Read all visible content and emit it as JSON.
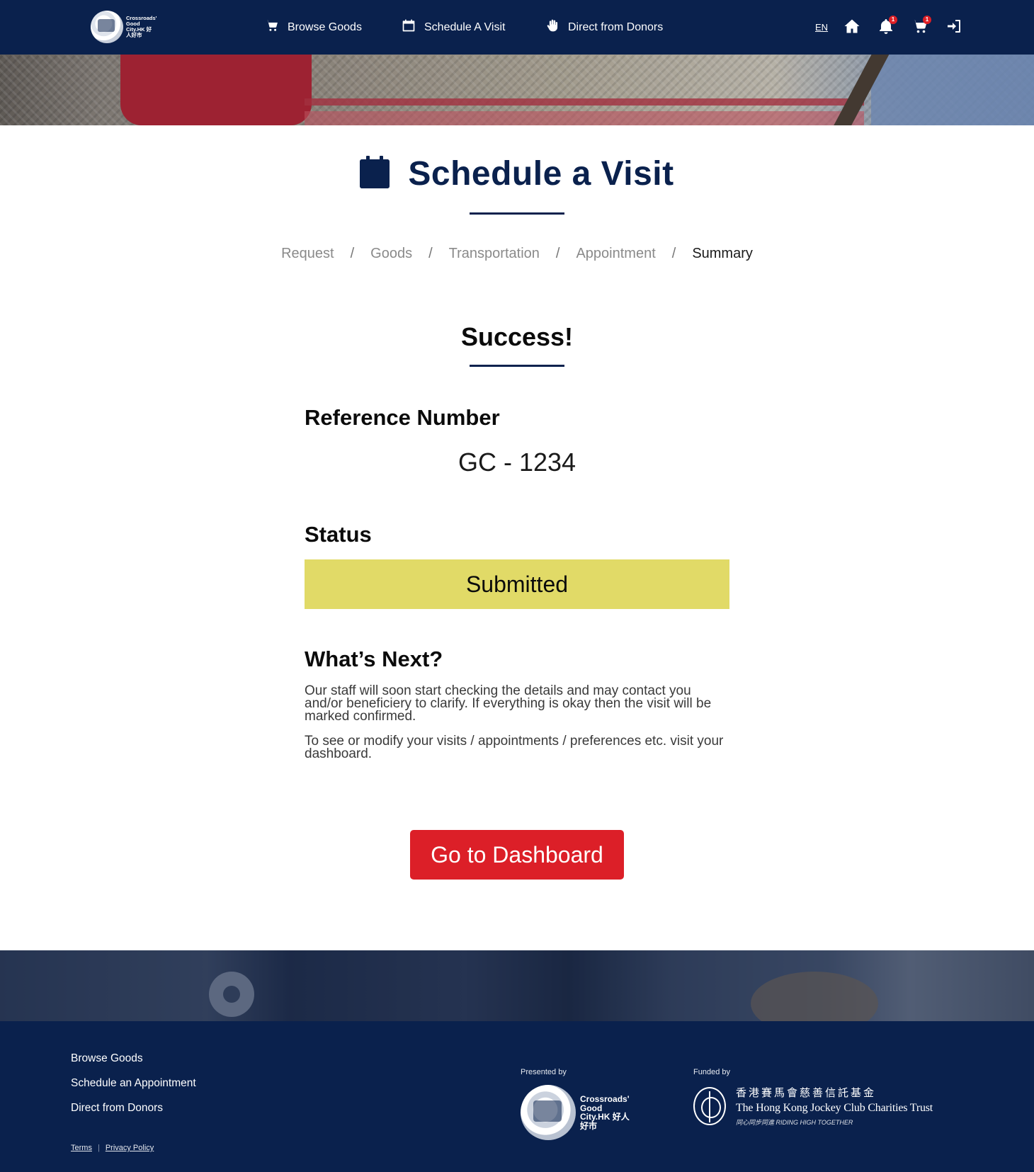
{
  "header": {
    "logo_text": "Crossroads' Good City.HK 好人好市",
    "nav": [
      {
        "label": "Browse Goods",
        "icon": "cart-icon"
      },
      {
        "label": "Schedule A Visit",
        "icon": "calendar-icon"
      },
      {
        "label": "Direct from Donors",
        "icon": "hand-icon"
      }
    ],
    "language": "EN",
    "notifications_badge": "1",
    "cart_badge": "1",
    "icons": [
      "home-icon",
      "bell-icon",
      "cart-icon",
      "login-icon"
    ]
  },
  "page": {
    "title": "Schedule a Visit",
    "title_icon": "calendar-icon",
    "steps": [
      "Request",
      "Goods",
      "Transportation",
      "Appointment",
      "Summary"
    ],
    "step_separator": "/",
    "active_step": "Summary"
  },
  "result": {
    "heading": "Success!",
    "reference_label": "Reference Number",
    "reference_value": "GC - 1234",
    "status_label": "Status",
    "status_value": "Submitted",
    "status_color": "#e1da67",
    "next_label": "What’s Next?",
    "next_paragraph_1": "Our staff will soon start checking the details and may contact you and/or beneficiery to clarify. If everything is okay then the visit will be marked confirmed.",
    "next_paragraph_2": "To see or modify your visits / appointments / preferences etc. visit your dashboard.",
    "cta_label": "Go to Dashboard",
    "cta_color": "#dc1f28"
  },
  "footer": {
    "links": [
      "Browse Goods",
      "Schedule an Appointment",
      "Direct from Donors"
    ],
    "terms": "Terms",
    "legal_separator": "|",
    "privacy": "Privacy Policy",
    "presented_by": "Presented by",
    "presenter_logo_text": "Crossroads' Good City.HK 好人好市",
    "funded_by": "Funded by",
    "funder_name_cn": "香港賽馬會慈善信託基金",
    "funder_name_en": "The Hong Kong Jockey Club Charities Trust",
    "funder_tagline": "同心同步同進 RIDING HIGH TOGETHER"
  },
  "colors": {
    "navy": "#0a214d",
    "accent_red": "#dc1f28",
    "status_yellow": "#e1da67"
  }
}
